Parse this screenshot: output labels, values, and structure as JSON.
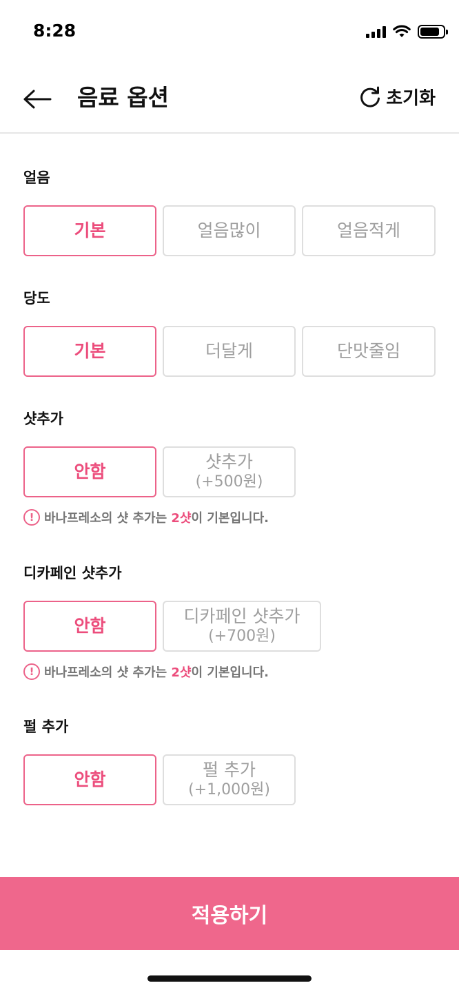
{
  "status": {
    "time": "8:28",
    "battery_level": 0.85
  },
  "header": {
    "title": "음료 옵션",
    "reset_label": "초기화"
  },
  "sections": [
    {
      "title": "얼음",
      "options": [
        {
          "label": "기본",
          "selected": true
        },
        {
          "label": "얼음많이"
        },
        {
          "label": "얼음적게"
        }
      ]
    },
    {
      "title": "당도",
      "options": [
        {
          "label": "기본",
          "selected": true
        },
        {
          "label": "더달게"
        },
        {
          "label": "단맛줄임"
        }
      ]
    },
    {
      "title": "샷추가",
      "options": [
        {
          "label": "안함",
          "selected": true
        },
        {
          "label": "샷추가",
          "price": "(+500원)"
        }
      ],
      "notice": {
        "icon": "!",
        "before": "바나프레소의 샷 추가는 ",
        "highlight": "2샷",
        "after": "이 기본입니다."
      }
    },
    {
      "title": "디카페인 샷추가",
      "options": [
        {
          "label": "안함",
          "selected": true
        },
        {
          "label": "디카페인 샷추가",
          "price": "(+700원)"
        }
      ],
      "notice": {
        "icon": "!",
        "before": "바나프레소의 샷 추가는 ",
        "highlight": "2샷",
        "after": "이 기본입니다."
      }
    },
    {
      "title": "펄 추가",
      "options": [
        {
          "label": "안함",
          "selected": true
        },
        {
          "label": "펄 추가",
          "price": "(+1,000원)"
        }
      ]
    }
  ],
  "apply_label": "적용하기",
  "colors": {
    "accent": "#ec6289",
    "apply_button": "#ef678c",
    "unselected_text": "#9e9e9e",
    "border": "#dedede"
  }
}
